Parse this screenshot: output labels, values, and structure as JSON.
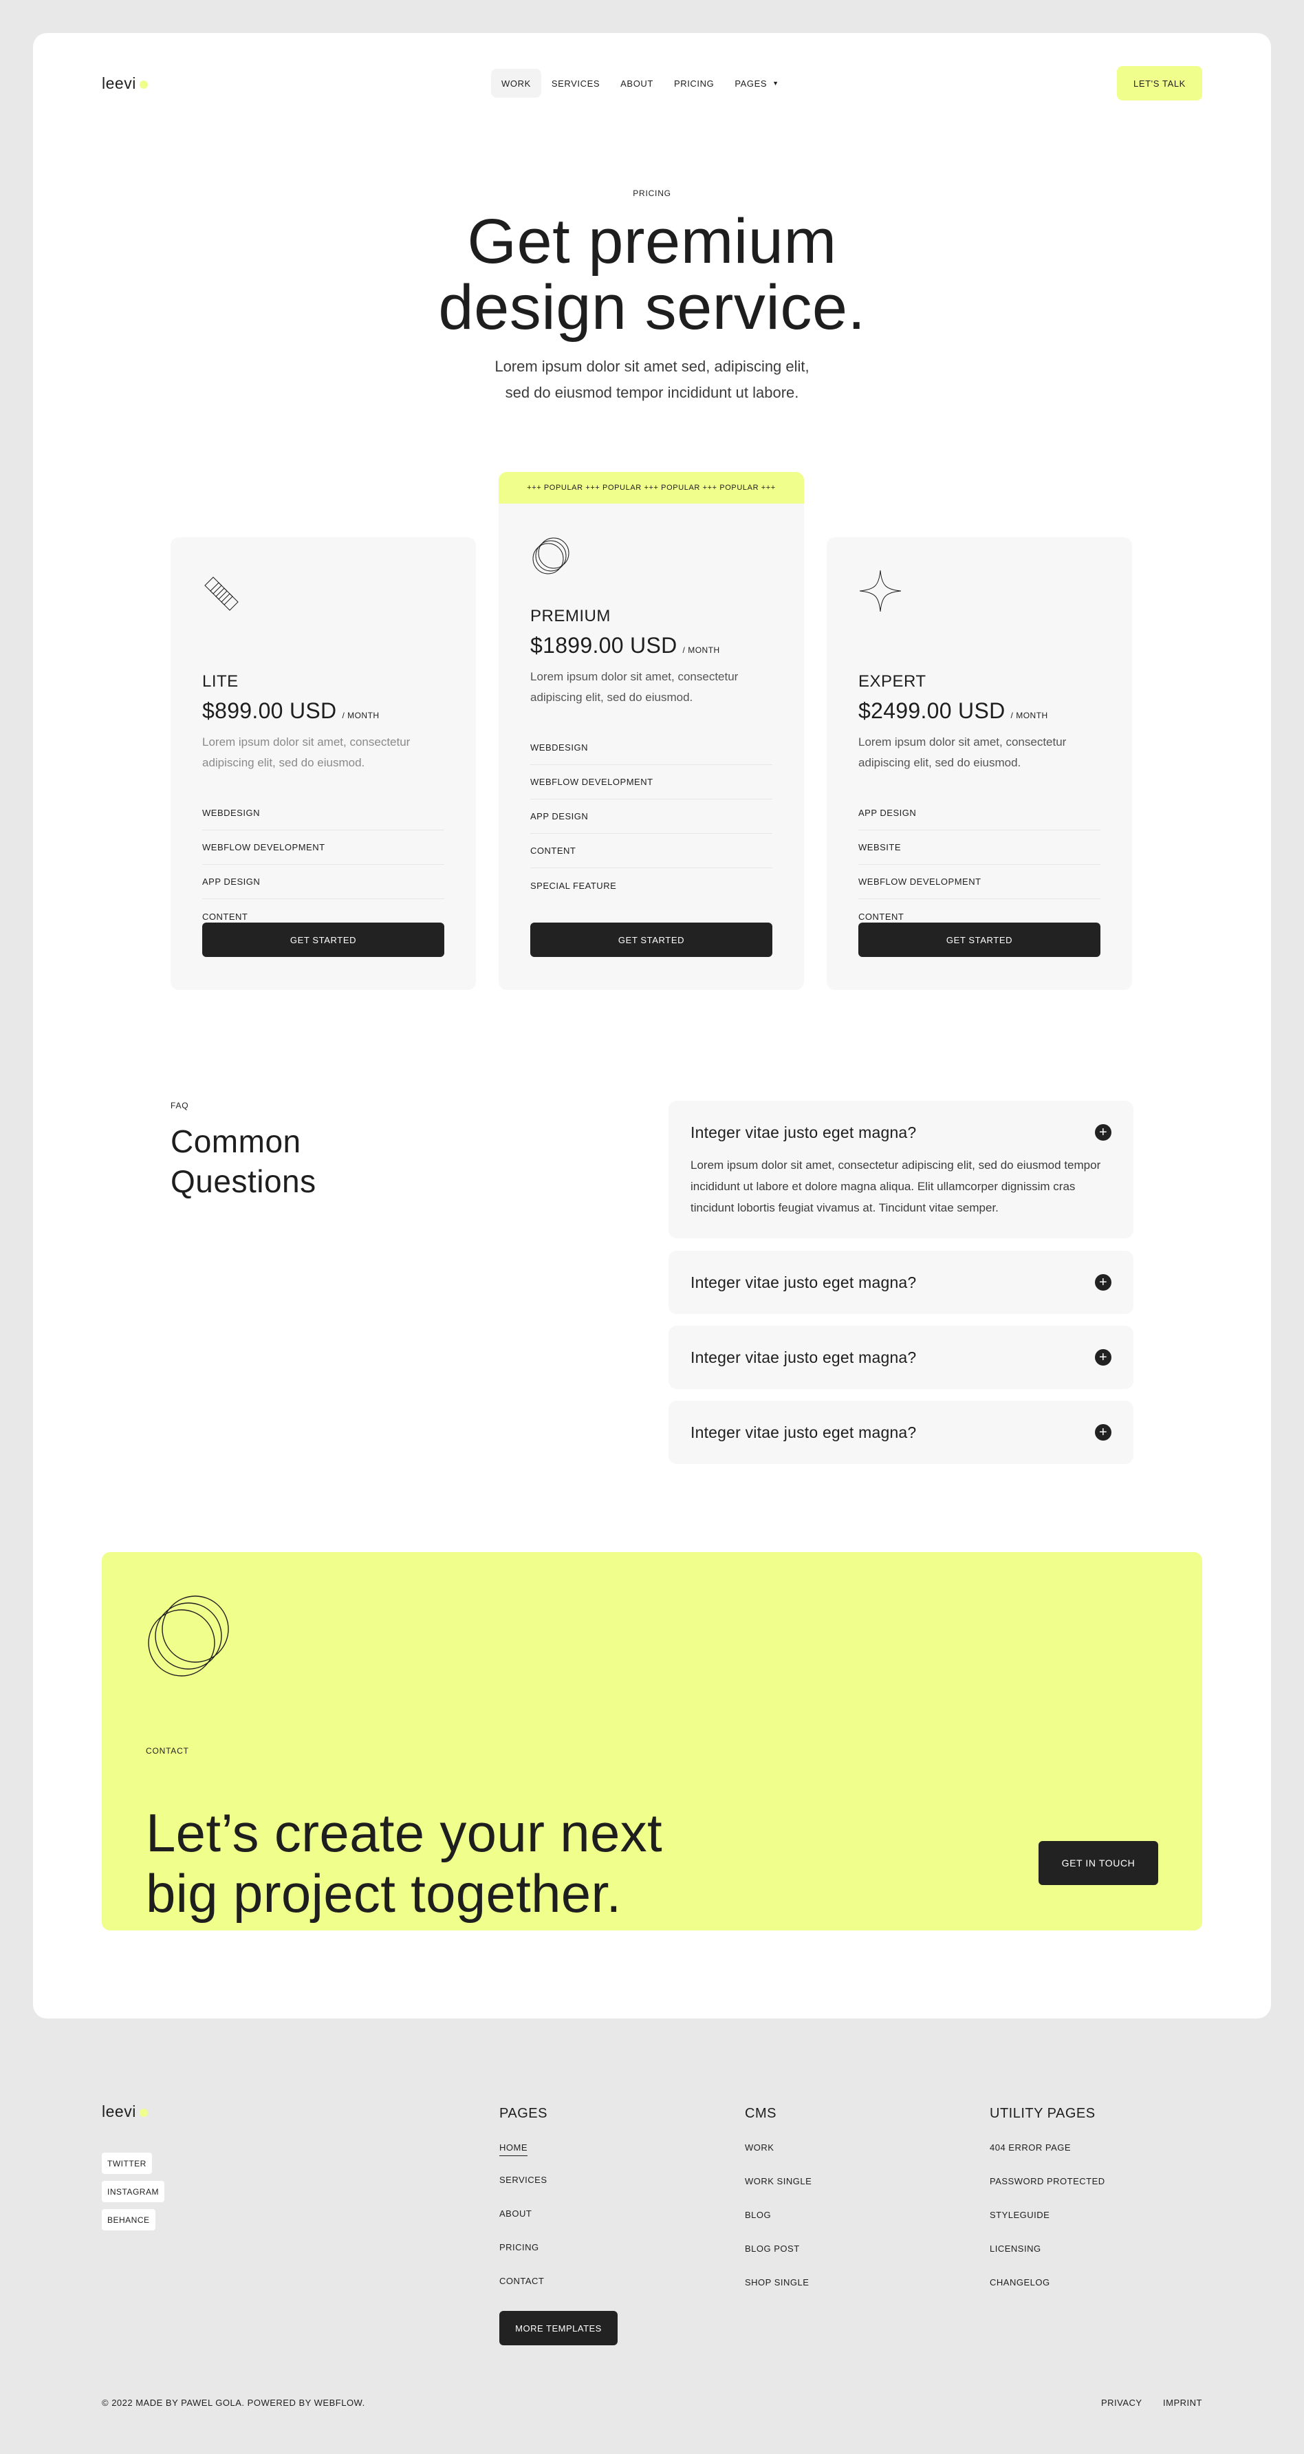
{
  "brand": {
    "logo_text": "leevi",
    "accent_color": "#f0ff8c",
    "dark_color": "#222222"
  },
  "nav": {
    "items": [
      "WORK",
      "SERVICES",
      "ABOUT",
      "PRICING",
      "PAGES"
    ],
    "active": "WORK",
    "cta_label": "LET'S TALK"
  },
  "hero": {
    "eyebrow": "PRICING",
    "title_line1": "Get premium",
    "title_line2": "design service.",
    "subtitle_line1": "Lorem ipsum dolor sit amet sed, adipiscing elit,",
    "subtitle_line2": "sed do eiusmod tempor incididunt ut labore."
  },
  "pricing": {
    "popular_banner": "+++ POPULAR +++ POPULAR +++ POPULAR +++ POPULAR +++",
    "per_label": "/ MONTH",
    "button_label": "GET STARTED",
    "plans": [
      {
        "name": "LITE",
        "price": "$899.00 USD",
        "description": "Lorem ipsum dolor sit amet, consectetur adipiscing elit, sed do eiusmod.",
        "features": [
          "WEBDESIGN",
          "WEBFLOW DEVELOPMENT",
          "APP DESIGN",
          "CONTENT"
        ],
        "icon": "stacked-squares-icon"
      },
      {
        "name": "PREMIUM",
        "price": "$1899.00 USD",
        "description": "Lorem ipsum dolor sit amet, consectetur adipiscing elit, sed do eiusmod.",
        "features": [
          "WEBDESIGN",
          "WEBFLOW DEVELOPMENT",
          "APP DESIGN",
          "CONTENT",
          "SPECIAL FEATURE"
        ],
        "icon": "overlapping-circles-icon"
      },
      {
        "name": "EXPERT",
        "price": "$2499.00 USD",
        "description": "Lorem ipsum dolor sit amet, consectetur adipiscing elit, sed do eiusmod.",
        "features": [
          "APP DESIGN",
          "WEBSITE",
          "WEBFLOW DEVELOPMENT",
          "CONTENT"
        ],
        "icon": "four-point-star-icon"
      }
    ]
  },
  "faq": {
    "eyebrow": "FAQ",
    "title_line1": "Common",
    "title_line2": "Questions",
    "items": [
      {
        "question": "Integer vitae justo eget magna?",
        "answer": "Lorem ipsum dolor sit amet, consectetur adipiscing elit, sed do eiusmod tempor incididunt ut labore et dolore magna aliqua. Elit ullamcorper dignissim cras tincidunt lobortis feugiat vivamus at. Tincidunt vitae semper.",
        "open": true
      },
      {
        "question": "Integer vitae justo eget magna?",
        "open": false
      },
      {
        "question": "Integer vitae justo eget magna?",
        "open": false
      },
      {
        "question": "Integer vitae justo eget magna?",
        "open": false
      }
    ],
    "plus_glyph": "+"
  },
  "cta": {
    "eyebrow": "CONTACT",
    "title_line1": "Let’s create your next",
    "title_line2": "big project together.",
    "button_label": "GET IN TOUCH",
    "icon": "overlapping-circles-icon"
  },
  "footer": {
    "logo_text": "leevi",
    "social": [
      "TWITTER",
      "INSTAGRAM",
      "BEHANCE"
    ],
    "columns": [
      {
        "title": "PAGES",
        "links": [
          "HOME",
          "SERVICES",
          "ABOUT",
          "PRICING",
          "CONTACT"
        ],
        "current": "HOME"
      },
      {
        "title": "CMS",
        "links": [
          "WORK",
          "WORK SINGLE",
          "BLOG",
          "BLOG POST",
          "SHOP SINGLE"
        ]
      },
      {
        "title": "UTILITY PAGES",
        "links": [
          "404 ERROR PAGE",
          "PASSWORD PROTECTED",
          "STYLEGUIDE",
          "LICENSING",
          "CHANGELOG"
        ]
      }
    ],
    "more_templates_label": "MORE TEMPLATES",
    "copyright": "© 2022 MADE BY PAWEL GOLA. POWERED BY WEBFLOW.",
    "legal": [
      "PRIVACY",
      "IMPRINT"
    ]
  }
}
